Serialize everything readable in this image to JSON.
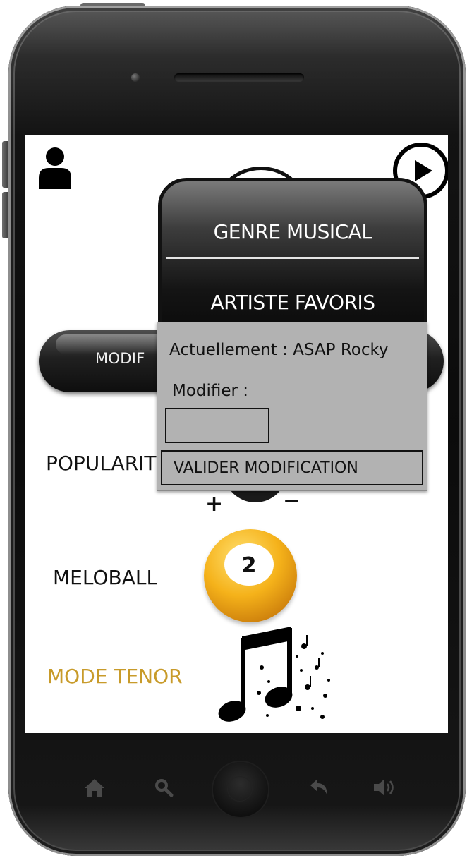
{
  "top_bar": {
    "user_icon": "user-icon",
    "play_icon": "play-icon"
  },
  "main": {
    "modify_button_label": "MODIF",
    "popularity_label": "POPULARIT",
    "popularity_plus": "+",
    "popularity_minus": "−",
    "meloball_label": "MELOBALL",
    "meloball_value": "2",
    "tenor_label": "MODE TENOR",
    "tenor_color": "#c89b2a",
    "meloball_color": "#f5b21a"
  },
  "menu": {
    "items": [
      {
        "label": "GENRE MUSICAL"
      },
      {
        "label": "ARTISTE FAVORIS"
      }
    ]
  },
  "panel": {
    "current_text": "Actuellement : ASAP Rocky",
    "modify_label": "Modifier :",
    "input_value": "",
    "validate_label": "VALIDER MODIFICATION"
  },
  "bottom_nav": {
    "icons": [
      "home-icon",
      "search-icon",
      "back-icon",
      "volume-icon"
    ]
  }
}
